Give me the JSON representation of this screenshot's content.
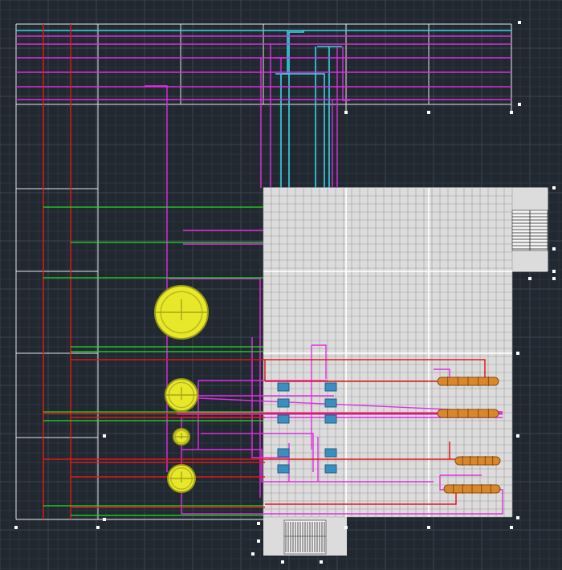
{
  "colors": {
    "background": "#212830",
    "grid_minor": "#2c3540",
    "grid_major": "#3a4553",
    "sheet": "#dcdcdc",
    "sheet_grid": "#9a9a9a",
    "white": "#e8e8e8",
    "cyan": "#35d7e8",
    "magenta": "#e02ee0",
    "red": "#e01818",
    "green": "#22e022",
    "yellow": "#e8e82a",
    "valve": "#3b8fc0",
    "tube": "#d8882a"
  },
  "elements": {
    "tanks": "yellow-sphere-tank",
    "valves": "blue-valve-block",
    "heaters": "orange-tube-heater",
    "grips": "grip-point",
    "legend_tables": "title-block"
  }
}
